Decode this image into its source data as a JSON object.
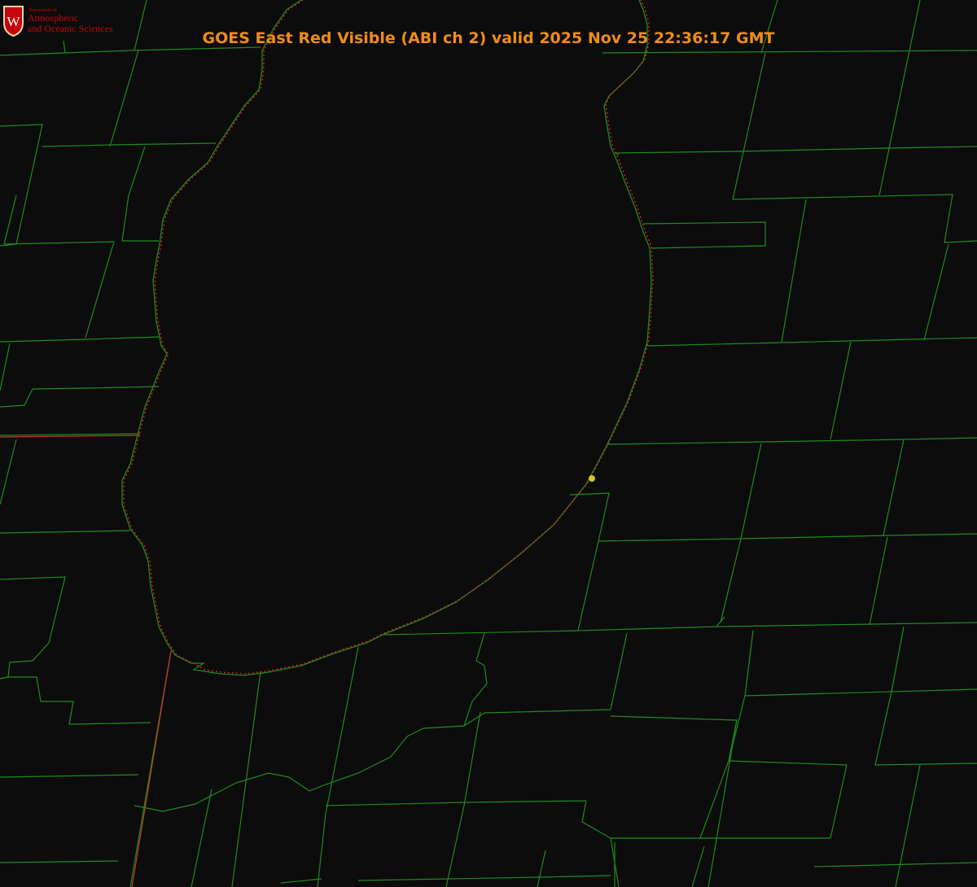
{
  "title": "GOES East Red Visible (ABI ch 2) valid 2025 Nov 25 22:36:17 GMT",
  "logo": {
    "shield_letter": "W",
    "department_line": "Department of",
    "line1": "Atmospheric",
    "line2": "and Oceanic Sciences"
  },
  "colors": {
    "background": "#0c0c0c",
    "title": "#f08c1a",
    "county_lines": "#1f8a1f",
    "state_lines": "#c0392b",
    "coastline_dots": "#e02020",
    "marker": "#d8c22a",
    "logo_text": "#c5050c"
  },
  "map_layers": [
    "county-boundaries",
    "state-boundaries",
    "lake-shoreline",
    "station-marker"
  ],
  "marker_icon": "yellow-dot-icon"
}
